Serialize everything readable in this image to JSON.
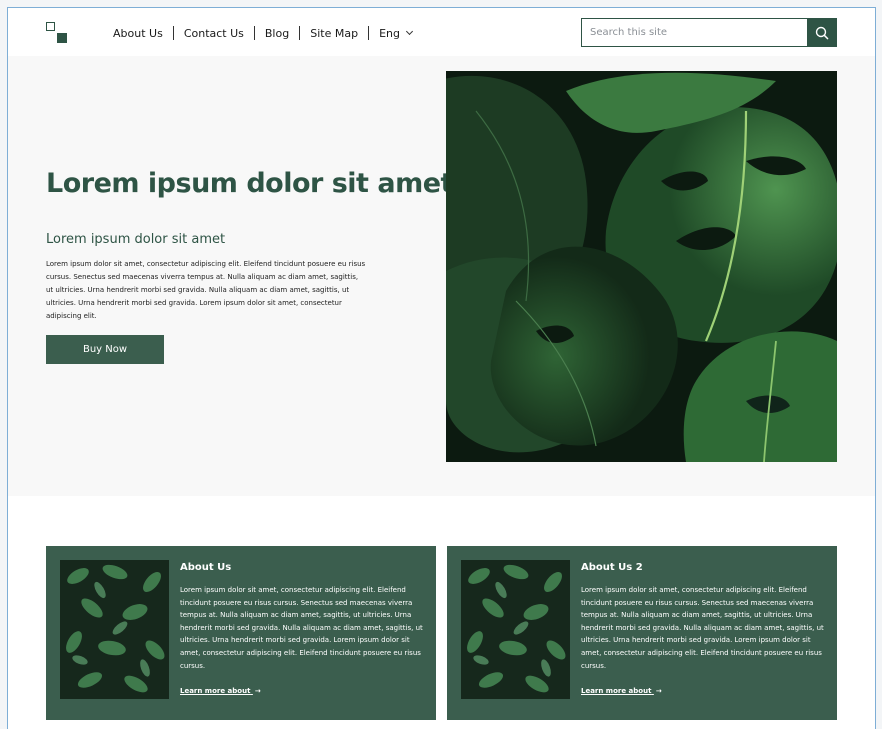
{
  "nav": {
    "items": [
      "About Us",
      "Contact Us",
      "Blog",
      "Site Map"
    ],
    "language": "Eng"
  },
  "search": {
    "placeholder": "Search this site"
  },
  "hero": {
    "title": "Lorem ipsum dolor sit amet",
    "subtitle": "Lorem ipsum dolor sit amet",
    "body": "Lorem ipsum dolor sit amet, consectetur adipiscing elit. Eleifend tincidunt posuere eu risus cursus. Senectus sed maecenas viverra tempus at. Nulla aliquam ac diam amet, sagittis, ut ultricies. Urna hendrerit morbi sed gravida. Nulla aliquam ac diam amet, sagittis, ut ultricies. Urna hendrerit morbi sed gravida. Lorem ipsum dolor sit amet, consectetur adipiscing elit.",
    "button": "Buy Now"
  },
  "cards": [
    {
      "title": "About Us",
      "body": "Lorem ipsum dolor sit amet, consectetur adipiscing elit. Eleifend tincidunt posuere eu risus cursus. Senectus sed maecenas viverra tempus at. Nulla aliquam ac diam amet, sagittis, ut ultricies. Urna hendrerit morbi sed gravida. Nulla aliquam ac diam amet, sagittis, ut ultricies. Urna hendrerit morbi sed gravida. Lorem ipsum dolor sit amet, consectetur adipiscing elit. Eleifend tincidunt posuere eu risus cursus.",
      "link": "Learn more about"
    },
    {
      "title": "About Us 2",
      "body": "Lorem ipsum dolor sit amet, consectetur adipiscing elit. Eleifend tincidunt posuere eu risus cursus. Senectus sed maecenas viverra tempus at. Nulla aliquam ac diam amet, sagittis, ut ultricies. Urna hendrerit morbi sed gravida. Nulla aliquam ac diam amet, sagittis, ut ultricies. Urna hendrerit morbi sed gravida. Lorem ipsum dolor sit amet, consectetur adipiscing elit. Eleifend tincidunt posuere eu risus cursus.",
      "link": "Learn more about"
    }
  ],
  "colors": {
    "brand_green": "#2e5445",
    "card_green": "#3b5e4e",
    "hero_background": "#f8f8f8"
  },
  "icons": {
    "logo": "logo-icon",
    "search": "search-icon",
    "language_chevron": "chevron-down-icon",
    "link_arrow": "arrow-right-icon"
  }
}
